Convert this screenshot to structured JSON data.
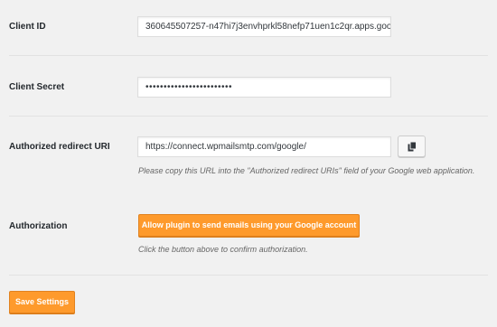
{
  "client_id": {
    "label": "Client ID",
    "value": "360645507257-n47hi7j3envhprkl58nefp71uen1c2qr.apps.goo"
  },
  "client_secret": {
    "label": "Client Secret",
    "value": "••••••••••••••••••••••••"
  },
  "redirect_uri": {
    "label": "Authorized redirect URI",
    "value": "https://connect.wpmailsmtp.com/google/",
    "description": "Please copy this URL into the \"Authorized redirect URIs\" field of your Google web application.",
    "copy_icon": "copy-icon"
  },
  "authorization": {
    "label": "Authorization",
    "button_label": "Allow plugin to send emails using your Google account",
    "description": "Click the button above to confirm authorization."
  },
  "save_button_label": "Save Settings",
  "colors": {
    "accent": "#fe9a2c",
    "background": "#f1f1f1"
  }
}
